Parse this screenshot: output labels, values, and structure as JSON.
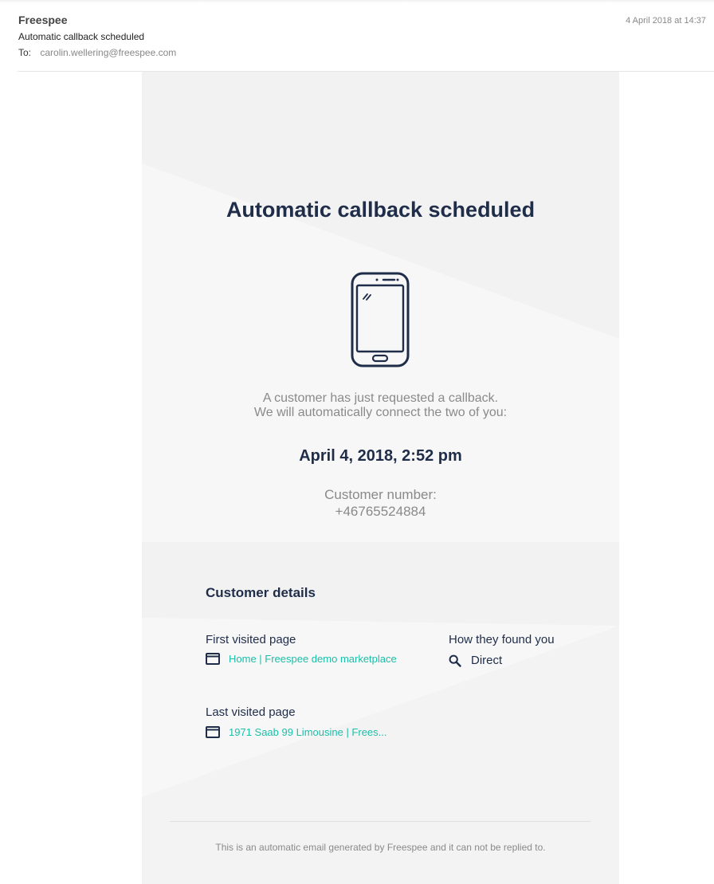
{
  "mail_header": {
    "sender": "Freespee",
    "subject": "Automatic callback scheduled",
    "to_label": "To:",
    "to_address": "carolin.wellering@freespee.com",
    "date": "4 April 2018 at 14:37"
  },
  "email": {
    "headline": "Automatic callback scheduled",
    "icon": "smartphone-icon",
    "intro_line1": "A customer has just requested a callback.",
    "intro_line2": "We will automatically connect the two of you:",
    "scheduled_time": "April 4, 2018, 2:52 pm",
    "customer_number_label": "Customer number:",
    "customer_number": "+46765524884",
    "customer_details": {
      "heading": "Customer details",
      "first_visited": {
        "label": "First visited page",
        "icon": "browser-window-icon",
        "value": "Home | Freespee demo marketplace"
      },
      "how_found": {
        "label": "How they found you",
        "icon": "search-icon",
        "value": "Direct"
      },
      "last_visited": {
        "label": "Last visited page",
        "icon": "browser-window-icon",
        "value": "1971 Saab 99 Limousine | Frees..."
      }
    },
    "footer": "This is an automatic email generated by Freespee and it can not be replied to."
  },
  "colors": {
    "heading": "#1f2d49",
    "link": "#1bbfa8",
    "muted_text": "#8a8a8a",
    "card_background": "#f2f2f3"
  }
}
